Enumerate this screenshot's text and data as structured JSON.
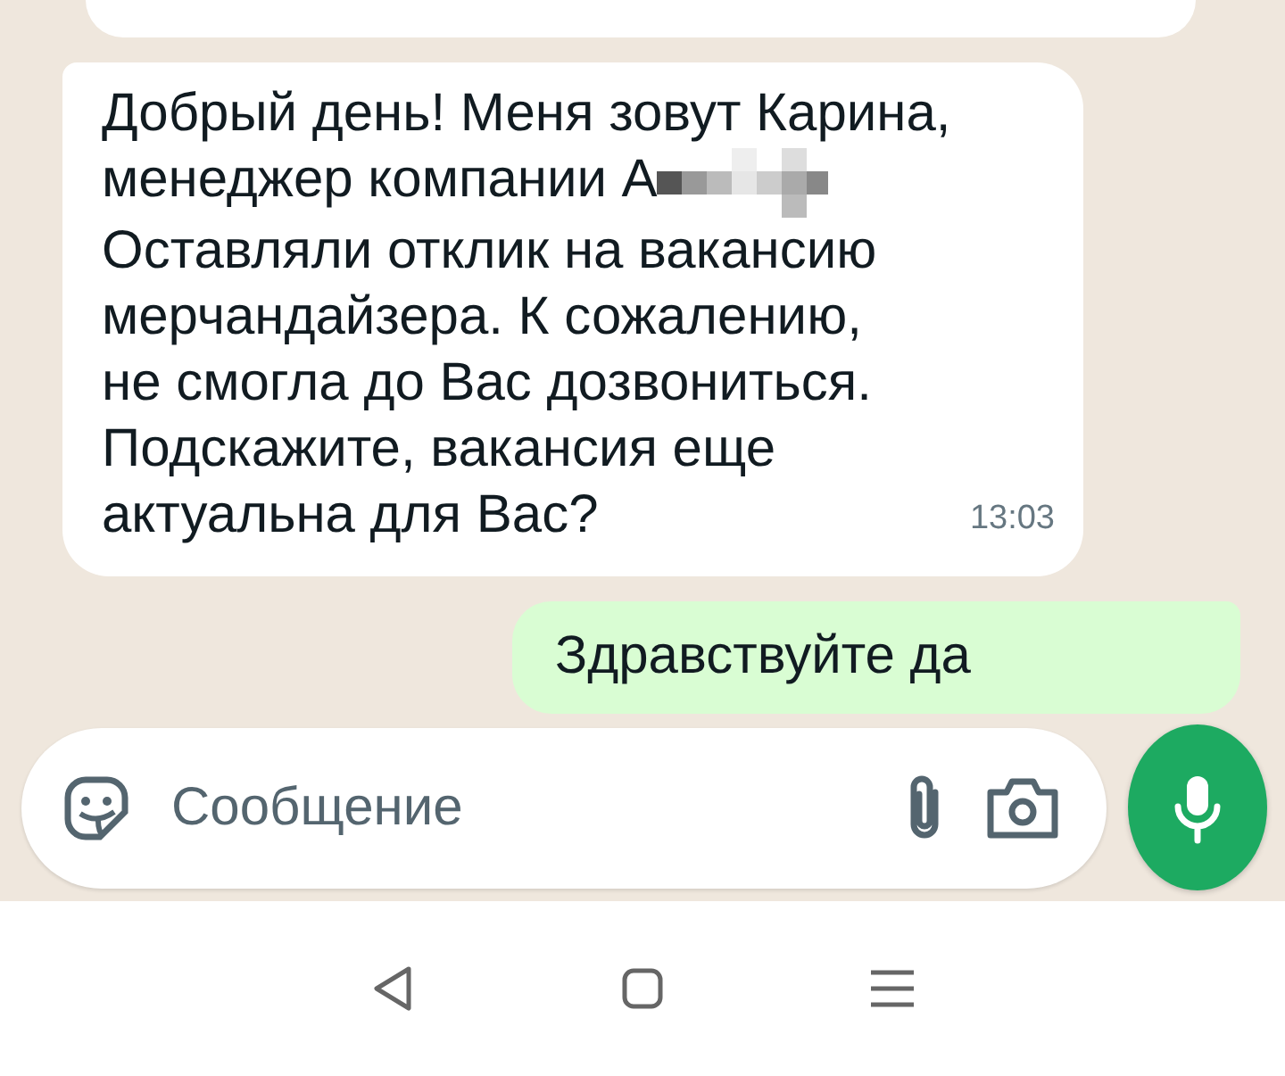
{
  "messages": [
    {
      "outgoing": false,
      "cut_top": true
    },
    {
      "outgoing": false,
      "text": "Добрый день! Меня зовут Карина,\nменеджер компании А",
      "redacted": true,
      "text_after": "Оставляли отклик на вакансию\nмерчандайзера. К сожалению,\nне смогла до Вас дозвониться.\nПодскажите, вакансия еще\nактуальна для Вас?",
      "time": "13:03"
    },
    {
      "outgoing": true,
      "text": "Здравствуйте да"
    }
  ],
  "composer": {
    "placeholder": "Сообщение"
  }
}
